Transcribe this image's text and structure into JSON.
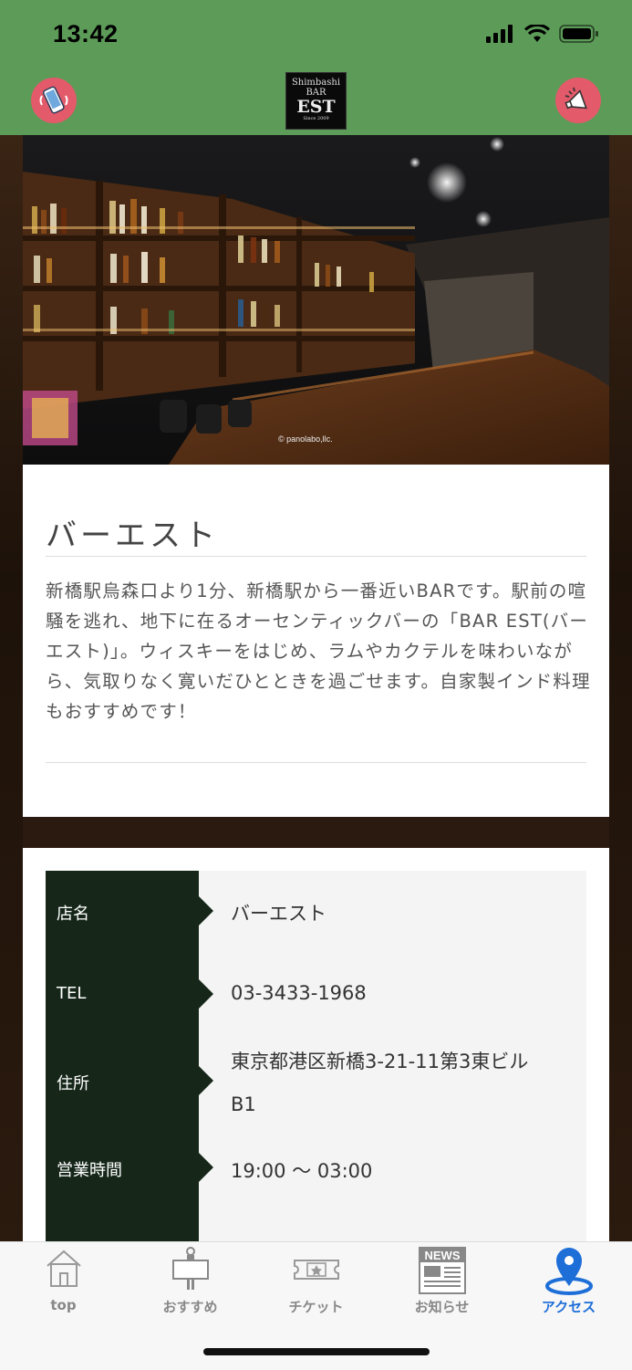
{
  "status": {
    "time": "13:42"
  },
  "header": {
    "logo": {
      "line1": "Shimbashi",
      "line2": "BAR",
      "line3": "EST",
      "line4": "Since 2009"
    },
    "left_icon": "phone-shake-icon",
    "right_icon": "megaphone-icon",
    "accent_color": "#e35a6a",
    "bar_color": "#5c9c58"
  },
  "hero": {
    "credit": "© panolabo,llc."
  },
  "about": {
    "title": "バーエスト",
    "description": "新橋駅烏森口より1分、新橋駅から一番近いBARです。駅前の喧騒を逃れ、地下に在るオーセンティックバーの「BAR EST(バーエスト)」。ウィスキーをはじめ、ラムやカクテルを味わいながら、気取りなく寛いだひとときを過ごせます。自家製インド料理もおすすめです！"
  },
  "info": {
    "rows": [
      {
        "label": "店名",
        "value": "バーエスト"
      },
      {
        "label": "TEL",
        "value": " 03-3433-1968"
      },
      {
        "label": "住所",
        "value": "東京都港区新橋3-21-11第3東ビル",
        "value2": "B1"
      },
      {
        "label": "営業時間",
        "value": "19:00 〜 03:00"
      }
    ]
  },
  "tabs": [
    {
      "label": "top",
      "icon": "home-icon"
    },
    {
      "label": "おすすめ",
      "icon": "recommend-sign-icon"
    },
    {
      "label": "チケット",
      "icon": "ticket-icon"
    },
    {
      "label": "お知らせ",
      "icon": "news-icon",
      "icon_text": "NEWS"
    },
    {
      "label": "アクセス",
      "icon": "map-pin-icon",
      "active": true
    }
  ]
}
